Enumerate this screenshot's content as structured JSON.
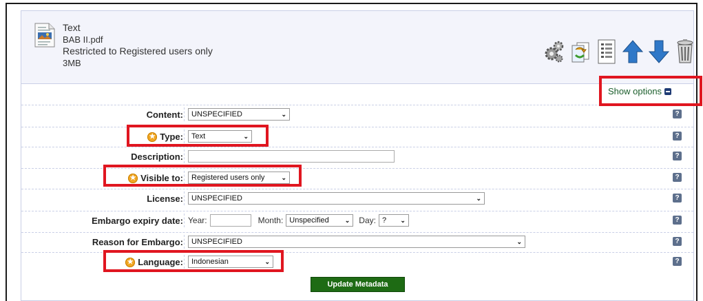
{
  "file": {
    "type": "Text",
    "name": "BAB II.pdf",
    "access": "Restricted to Registered users only",
    "size": "3MB"
  },
  "toolbar": {
    "icons": [
      "gears-icon",
      "convert-icon",
      "details-icon",
      "move-up-icon",
      "move-down-icon",
      "trash-icon"
    ]
  },
  "options": {
    "label": "Show options"
  },
  "fields": {
    "content": {
      "label": "Content:",
      "value": "UNSPECIFIED"
    },
    "type": {
      "label": "Type:",
      "value": "Text"
    },
    "description": {
      "label": "Description:",
      "value": ""
    },
    "visible": {
      "label": "Visible to:",
      "value": "Registered users only"
    },
    "license": {
      "label": "License:",
      "value": "UNSPECIFIED"
    },
    "embargo": {
      "label": "Embargo expiry date:",
      "year_label": "Year:",
      "year_value": "",
      "month_label": "Month:",
      "month_value": "Unspecified",
      "day_label": "Day:",
      "day_value": "?"
    },
    "reason": {
      "label": "Reason for Embargo:",
      "value": "UNSPECIFIED"
    },
    "language": {
      "label": "Language:",
      "value": "Indonesian"
    }
  },
  "help_glyph": "?",
  "submit_label": "Update Metadata",
  "colors": {
    "highlight": "#e01620",
    "button": "#1e6b14",
    "link": "#1b5e2c"
  }
}
